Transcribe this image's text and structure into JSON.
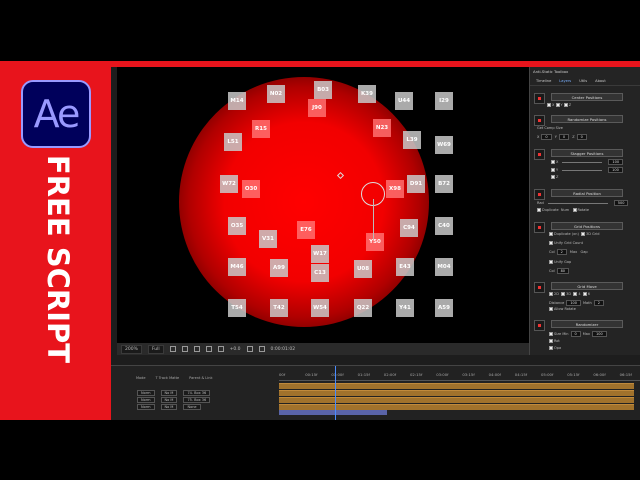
{
  "thumbnail": {
    "logo_text": "Ae",
    "side_title": "FREE SCRIPT",
    "frame_color": "#e8141c"
  },
  "viewer": {
    "boxes": [
      {
        "label": "B03",
        "red": false
      },
      {
        "label": "N02",
        "red": false
      },
      {
        "label": "K39",
        "red": false
      },
      {
        "label": "M14",
        "red": false
      },
      {
        "label": "J90",
        "red": true
      },
      {
        "label": "U44",
        "red": false
      },
      {
        "label": "I29",
        "red": false
      },
      {
        "label": "R15",
        "red": true
      },
      {
        "label": "N23",
        "red": true
      },
      {
        "label": "L51",
        "red": false
      },
      {
        "label": "L39",
        "red": false
      },
      {
        "label": "W69",
        "red": false
      },
      {
        "label": "W72",
        "red": false
      },
      {
        "label": "O30",
        "red": true
      },
      {
        "label": "X98",
        "red": true
      },
      {
        "label": "D91",
        "red": false
      },
      {
        "label": "B72",
        "red": false
      },
      {
        "label": "O35",
        "red": false
      },
      {
        "label": "E76",
        "red": true
      },
      {
        "label": "C94",
        "red": false
      },
      {
        "label": "C40",
        "red": false
      },
      {
        "label": "V31",
        "red": false
      },
      {
        "label": "W17",
        "red": false
      },
      {
        "label": "Y50",
        "red": true
      },
      {
        "label": "M46",
        "red": false
      },
      {
        "label": "A99",
        "red": false
      },
      {
        "label": "C13",
        "red": false
      },
      {
        "label": "U08",
        "red": false
      },
      {
        "label": "E43",
        "red": false
      },
      {
        "label": "M04",
        "red": false
      },
      {
        "label": "T54",
        "red": false
      },
      {
        "label": "T42",
        "red": false
      },
      {
        "label": "W54",
        "red": false
      },
      {
        "label": "Q22",
        "red": false
      },
      {
        "label": "Y41",
        "red": false
      },
      {
        "label": "A59",
        "red": false
      }
    ],
    "zoom": "200%",
    "resolution": "Full",
    "exposure": "+0.0",
    "timecode": "0:00:01:02"
  },
  "panel": {
    "title": "Anti-Static Toolbox",
    "tabs": [
      "Timeline",
      "Layers",
      "Utils",
      "About"
    ],
    "active_tab": "Layers",
    "axis_x": "X",
    "axis_y": "Y",
    "axis_z": "Z",
    "center_btn": "Center Positions",
    "randomize_btn": "Randomize Positions",
    "get_comp_size": "Get Comp Size",
    "comp_x": "X",
    "comp_x_val": "0",
    "comp_y": "Y",
    "comp_y_val": "0",
    "comp_z": "Z",
    "comp_z_val": "0",
    "stagger_btn": "Stagger Positions",
    "stagger_x_val": "100",
    "stagger_y_val": "100",
    "radial_btn": "Radial Position",
    "rad_label": "Rad",
    "rad_val": "500",
    "duplicate_label": "Duplicate",
    "num_label": "Num",
    "rotate_label": "Rotate",
    "grid_btn": "Grid Positions",
    "duplicate_num": "Duplicate (xn)",
    "grid_3d": "3D Grid",
    "unify_count": "Unify Grid Count",
    "col_label": "Col",
    "col_val": "2",
    "max_label": "Max",
    "gap_label": "Gap",
    "unify_gap": "Unify Gap",
    "gap_col": "Col",
    "gap_val": "80",
    "grid_move_btn": "Grid Move",
    "move_2d": "2D",
    "move_3d": "3D",
    "move_4": "4",
    "move_6": "6",
    "distance_label": "Distance",
    "distance_val": "100",
    "math_label": "Math",
    "math_val": "2",
    "allow_rotate": "Allow Rotate",
    "randomizer_btn": "Randomizer",
    "size_label": "Size",
    "min_label": "Min",
    "min_val": "0",
    "max_val_label": "Max",
    "max_val": "100",
    "rot_label": "Rot",
    "opacity_label": "Opa"
  },
  "timeline": {
    "headers": [
      "Mode",
      "T Track Matte",
      "Parent & Link"
    ],
    "rows": [
      {
        "mode": "Norm",
        "matte": "No M",
        "parent": "74. Box 36"
      },
      {
        "mode": "Norm",
        "matte": "No M",
        "parent": "75. Box 36"
      },
      {
        "mode": "Norm",
        "matte": "No M",
        "parent": "None"
      }
    ],
    "ticks": [
      "00f",
      "00:15f",
      "01:00f",
      "01:15f",
      "02:00f",
      "02:15f",
      "03:00f",
      "03:15f",
      "04:00f",
      "04:15f",
      "05:00f",
      "05:15f",
      "06:00f",
      "06:15f"
    ]
  }
}
